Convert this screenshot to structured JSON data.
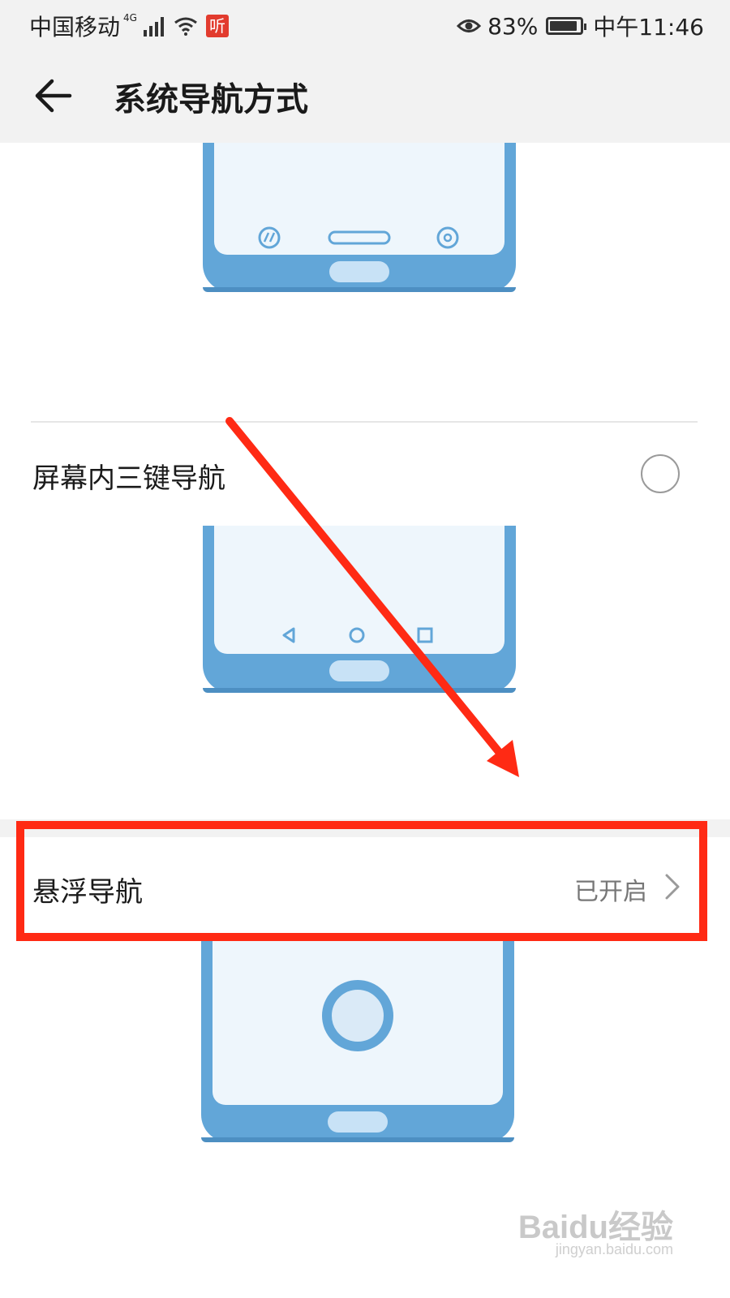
{
  "status_bar": {
    "carrier": "中国移动",
    "network": "4G",
    "app_badge": "听",
    "battery_percent": "83%",
    "battery_level": 0.83,
    "time": "中午11:46"
  },
  "header": {
    "back_icon": "arrow-left-icon",
    "title": "系统导航方式"
  },
  "options": [
    {
      "label": "屏幕内三键导航",
      "selected": false
    },
    {
      "label": "悬浮导航",
      "status": "已开启"
    }
  ],
  "annotation": {
    "color": "#ff2a14"
  },
  "watermark": {
    "brand": "Baidu经验",
    "url": "jingyan.baidu.com"
  },
  "colors": {
    "phone_body": "#62a6d8",
    "phone_screen": "#eef6fc",
    "accent": "#ff2a14"
  }
}
